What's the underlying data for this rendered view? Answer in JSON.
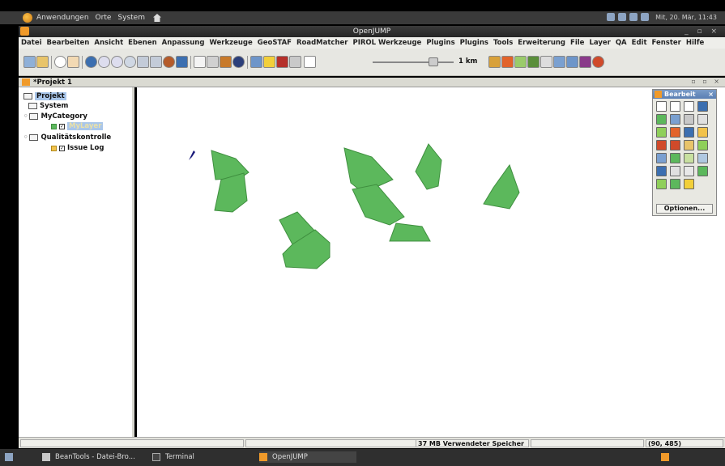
{
  "topbar": {
    "apps_label": "Anwendungen",
    "places_label": "Orte",
    "system_label": "System",
    "clock": "Mit, 20. Mär, 11:43"
  },
  "window": {
    "title": "OpenJUMP"
  },
  "menu": [
    "Datei",
    "Bearbeiten",
    "Ansicht",
    "Ebenen",
    "Anpassung",
    "Werkzeuge",
    "GeoSTAF",
    "RoadMatcher",
    "PIROL Werkzeuge",
    "Plugins",
    "Plugins",
    "Tools",
    "Erweiterung",
    "File",
    "Layer",
    "QA",
    "Edit",
    "Fenster",
    "Hilfe"
  ],
  "toolbar": {
    "scale_label": "1 km",
    "zoom_level": 0.75
  },
  "project_tab": {
    "label": "*Projekt 1"
  },
  "tree": {
    "root": "Projekt",
    "system": "System",
    "category": "MyCategory",
    "layer": "MyLayer",
    "qa_category": "Qualitätskontrolle",
    "issue_log": "Issue Log"
  },
  "edit_toolbox": {
    "title": "Bearbeit",
    "options_button": "Optionen..."
  },
  "status": {
    "memory": "37 MB Verwendeter Speicher",
    "coords": "(90, 485)"
  },
  "taskbar": {
    "items": [
      "BeanTools - Datei-Bro...",
      "Terminal",
      "OpenJUMP"
    ]
  },
  "colors": {
    "polygon_fill": "#5cb85c",
    "polygon_stroke": "#3f8f3f",
    "title_bar": "#262626",
    "selection": "#a9c6ea"
  }
}
